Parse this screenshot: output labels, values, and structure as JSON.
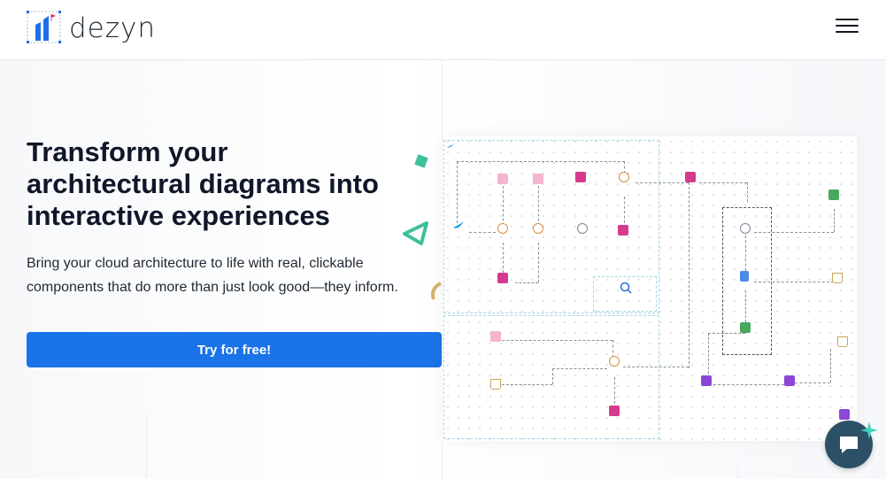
{
  "header": {
    "brand": "dezyn",
    "logo_icon": "dezyn-logo-icon",
    "menu_icon": "hamburger-menu-icon"
  },
  "hero": {
    "headline_line1": "Transform your",
    "headline_line2": "architectural diagrams into",
    "headline_highlight": "interactive",
    "headline_line3_rest": " experiences",
    "subtext": "Bring your cloud architecture to life with real, clickable components that do more than just look good—they inform.",
    "cta_label": "Try for free!"
  },
  "chat_widget": {
    "icon": "chat-bubble-icon"
  },
  "colors": {
    "cta": "#1a73e8",
    "highlight": "#9ff0df",
    "chat": "#2c5167"
  }
}
